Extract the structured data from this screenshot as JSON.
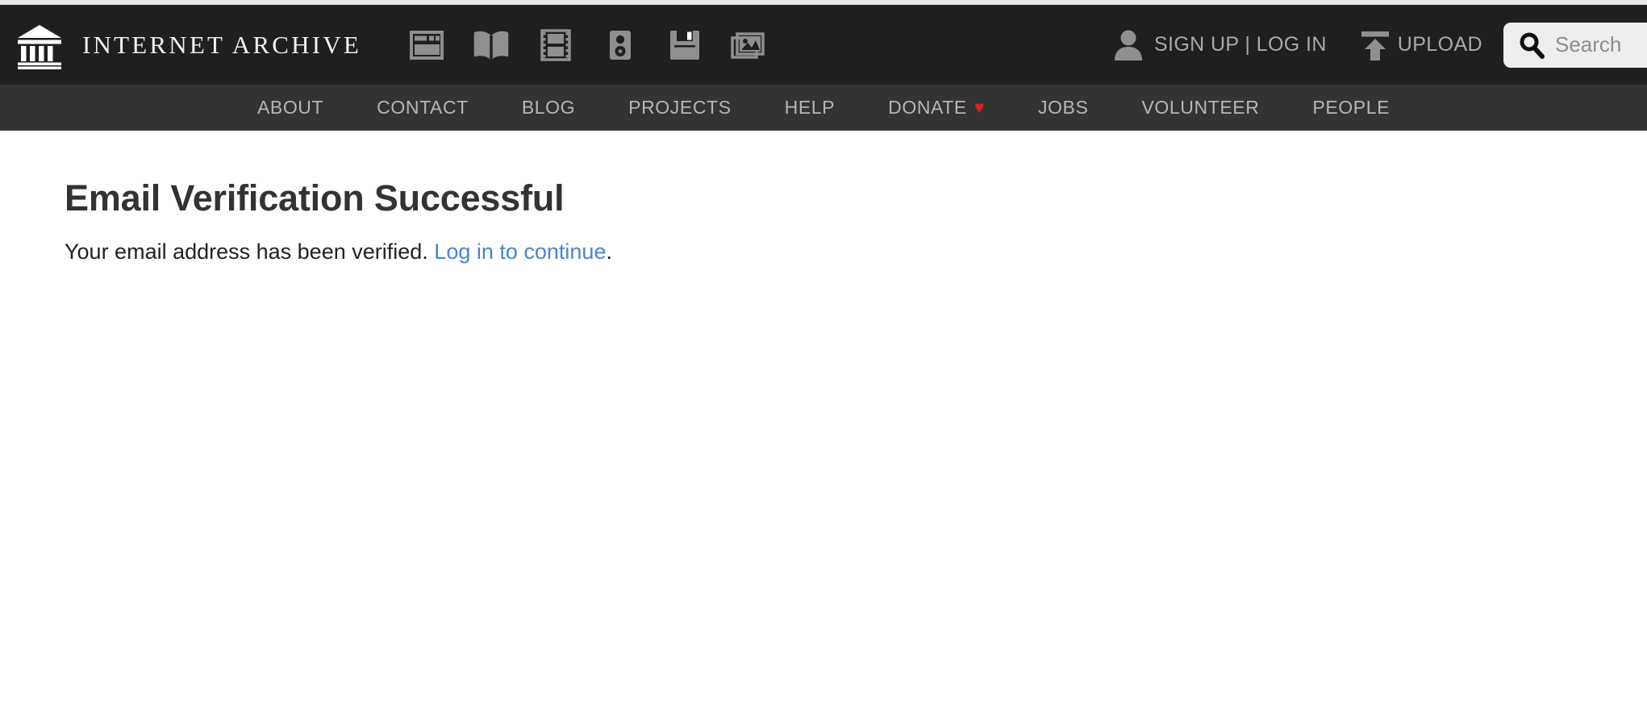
{
  "header": {
    "logo": {
      "icon": "internet-archive-building-icon",
      "text": "INTERNET ARCHIVE"
    },
    "media_icons": [
      {
        "name": "web-icon",
        "label": "Web"
      },
      {
        "name": "texts-book-icon",
        "label": "Texts"
      },
      {
        "name": "video-film-icon",
        "label": "Video"
      },
      {
        "name": "audio-speaker-icon",
        "label": "Audio"
      },
      {
        "name": "software-floppy-icon",
        "label": "Software"
      },
      {
        "name": "images-photos-icon",
        "label": "Images"
      }
    ],
    "account": {
      "icon": "person-icon",
      "label": "SIGN UP | LOG IN",
      "signup_label": "SIGN UP",
      "separator": "|",
      "login_label": "LOG IN"
    },
    "upload": {
      "icon": "upload-arrow-icon",
      "label": "UPLOAD"
    },
    "search": {
      "icon": "search-magnifier-icon",
      "placeholder": "Search",
      "value": ""
    }
  },
  "nav": {
    "items": [
      {
        "label": "ABOUT"
      },
      {
        "label": "CONTACT"
      },
      {
        "label": "BLOG"
      },
      {
        "label": "PROJECTS"
      },
      {
        "label": "HELP"
      },
      {
        "label": "DONATE",
        "heart": "♥"
      },
      {
        "label": "JOBS"
      },
      {
        "label": "VOLUNTEER"
      },
      {
        "label": "PEOPLE"
      }
    ]
  },
  "main": {
    "title": "Email Verification Successful",
    "message_before": "Your email address has been verified.",
    "link_label": "Log in to continue",
    "message_after": "."
  },
  "colors": {
    "header_bg": "#1f1f1f",
    "nav_bg": "#333333",
    "top_strip": "#e9e9e9",
    "nav_text": "#b6b6b6",
    "icon_gray": "#8f8f8f",
    "heart_red": "#e32020",
    "link_blue": "#4a86c8",
    "title_gray": "#333333",
    "search_bg": "#eeeeee"
  }
}
